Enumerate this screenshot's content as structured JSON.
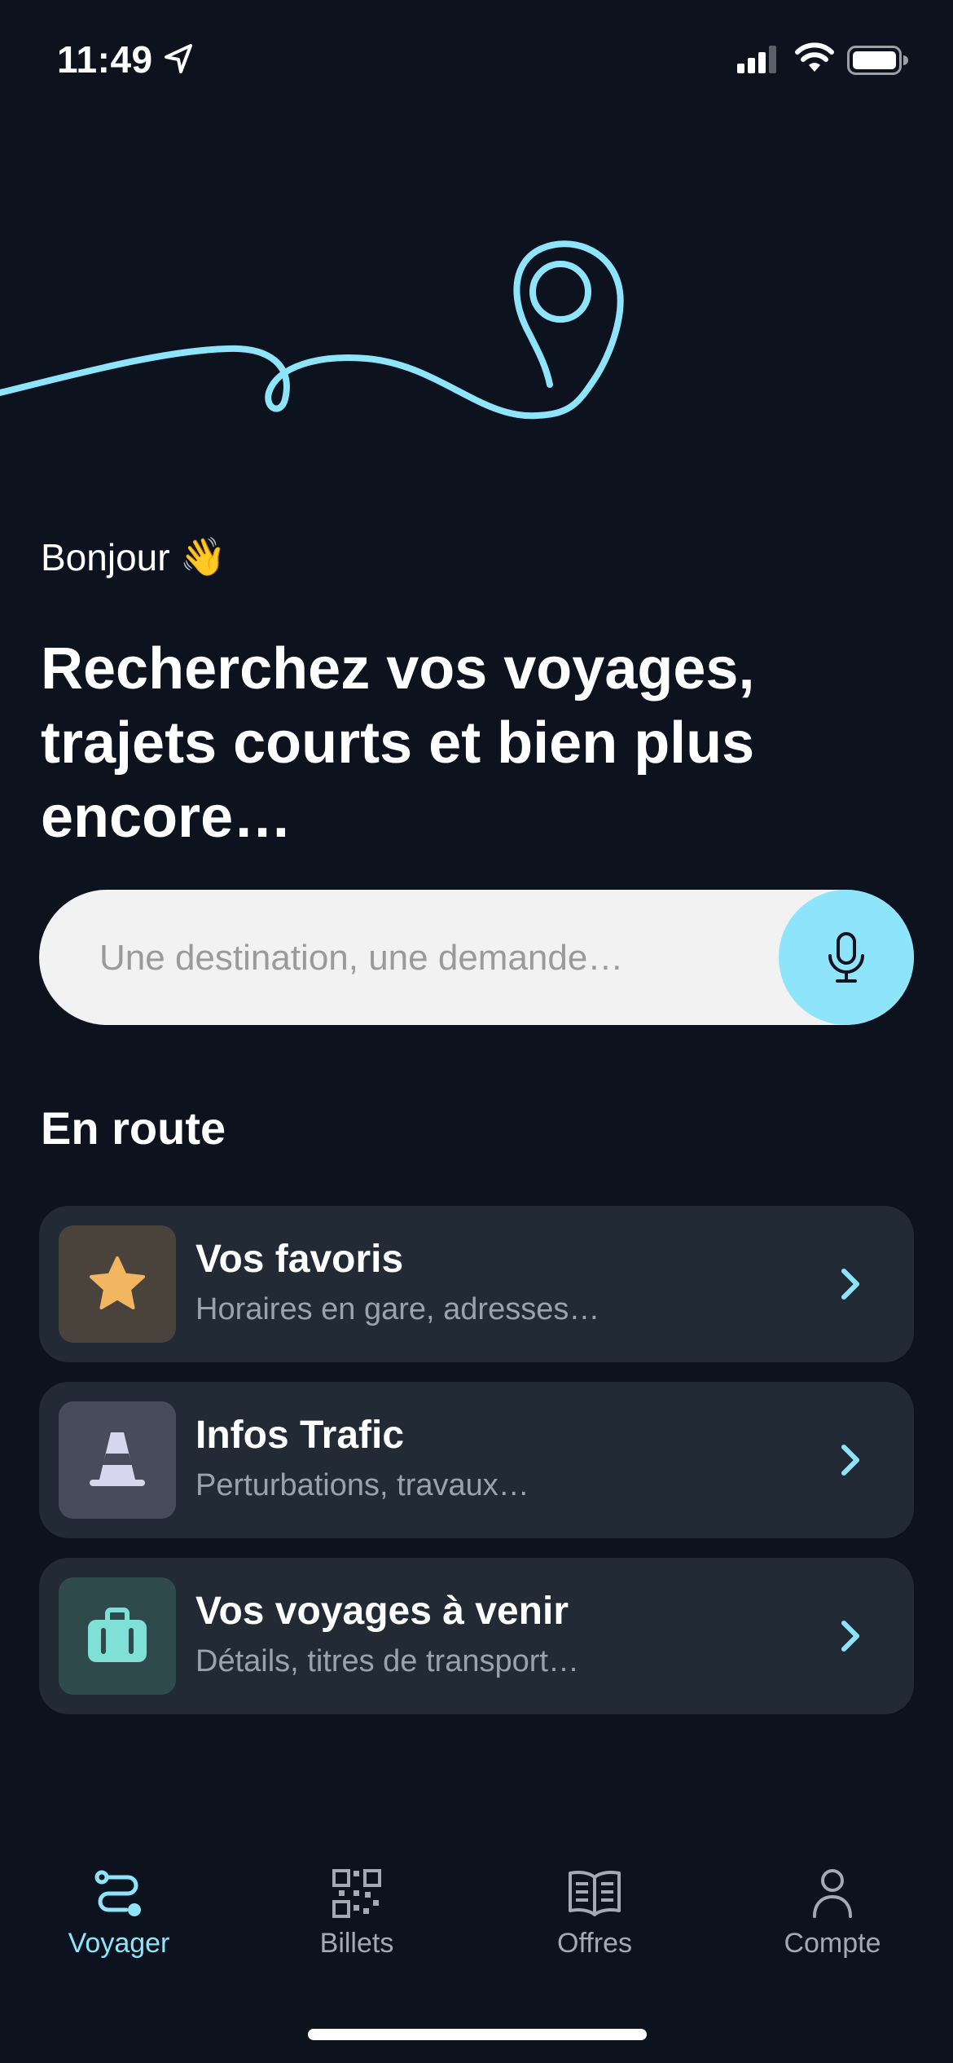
{
  "status": {
    "time": "11:49"
  },
  "greeting": {
    "text": "Bonjour",
    "emoji": "👋"
  },
  "headline": "Recherchez vos voyages, trajets courts et bien plus encore…",
  "search": {
    "placeholder": "Une destination, une demande…",
    "value": ""
  },
  "section": {
    "title": "En route"
  },
  "cards": [
    {
      "title": "Vos favoris",
      "subtitle": "Horaires en gare, adresses…",
      "icon": "star-icon",
      "icon_bg": "#4a433c",
      "icon_color": "#f2b661"
    },
    {
      "title": "Infos Trafic",
      "subtitle": "Perturbations, travaux…",
      "icon": "traffic-cone-icon",
      "icon_bg": "#474c5a",
      "icon_color": "#d8d6ef"
    },
    {
      "title": "Vos voyages à venir",
      "subtitle": "Détails, titres de transport…",
      "icon": "suitcase-icon",
      "icon_bg": "#2f4a4d",
      "icon_color": "#7fe0d6"
    }
  ],
  "tabs": [
    {
      "label": "Voyager",
      "icon": "route-icon",
      "active": true
    },
    {
      "label": "Billets",
      "icon": "qr-code-icon",
      "active": false
    },
    {
      "label": "Offres",
      "icon": "book-icon",
      "active": false
    },
    {
      "label": "Compte",
      "icon": "person-icon",
      "active": false
    }
  ],
  "colors": {
    "background": "#0c121e",
    "accent": "#8de4fb",
    "card": "#222a35",
    "search_bg": "#f2f2f2"
  }
}
